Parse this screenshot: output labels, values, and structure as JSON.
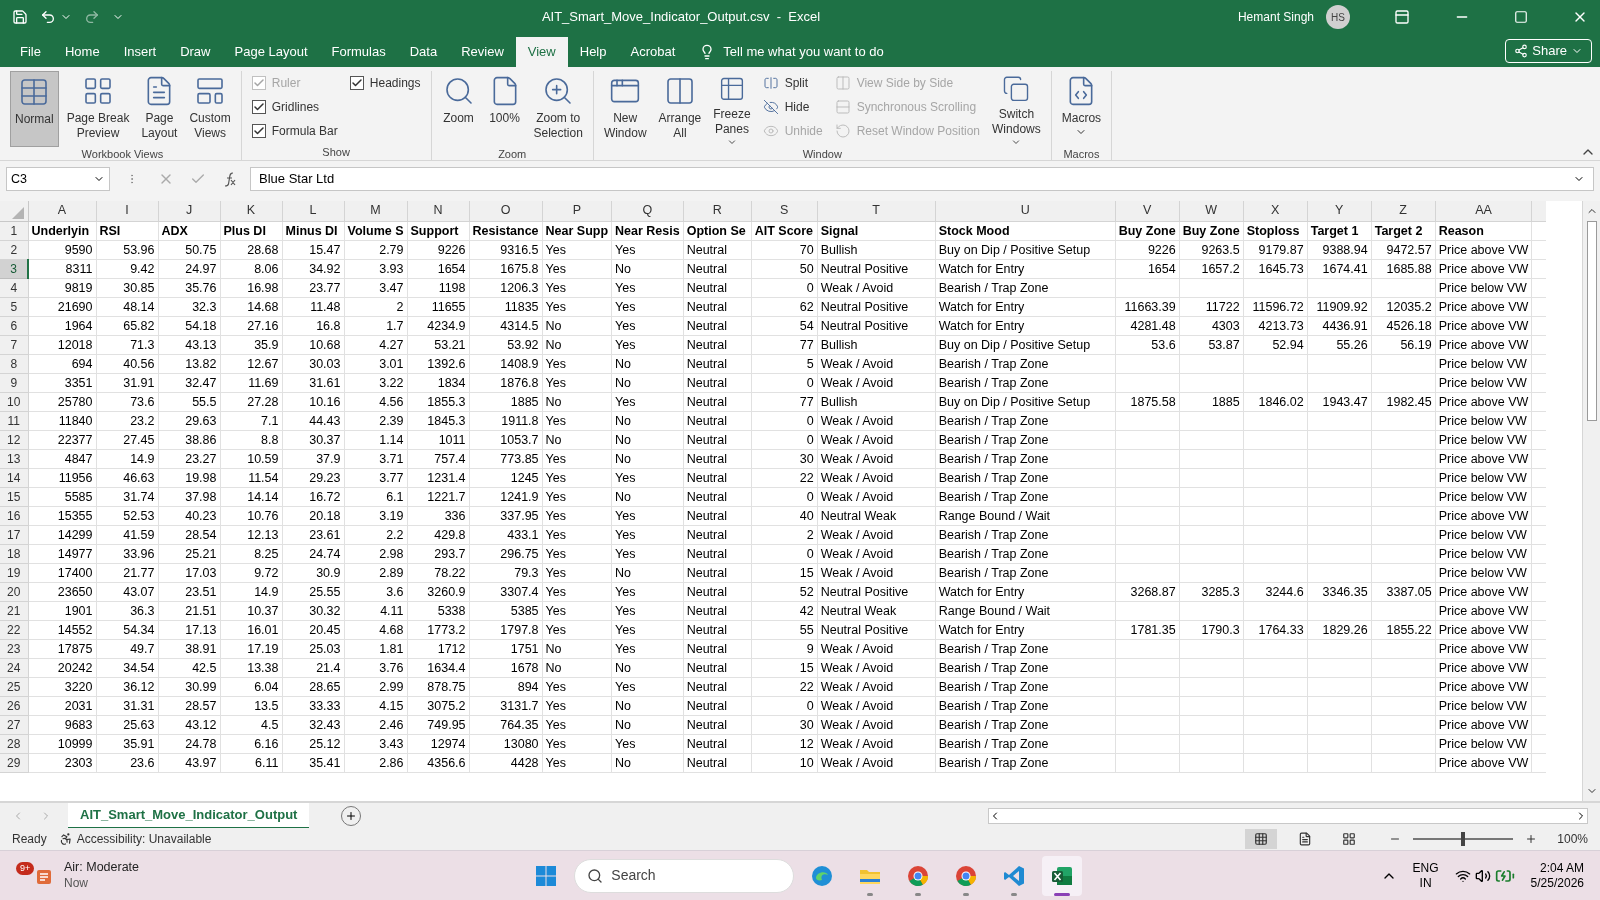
{
  "title_bar": {
    "file_title": "AIT_Smart_Move_Indicator_Output.csv  -  Excel",
    "user_name": "Hemant Singh",
    "user_initials": "HS"
  },
  "ribbon_tabs": [
    {
      "label": "File",
      "selected": false
    },
    {
      "label": "Home",
      "selected": false
    },
    {
      "label": "Insert",
      "selected": false
    },
    {
      "label": "Draw",
      "selected": false
    },
    {
      "label": "Page Layout",
      "selected": false
    },
    {
      "label": "Formulas",
      "selected": false
    },
    {
      "label": "Data",
      "selected": false
    },
    {
      "label": "Review",
      "selected": false
    },
    {
      "label": "View",
      "selected": true
    },
    {
      "label": "Help",
      "selected": false
    },
    {
      "label": "Acrobat",
      "selected": false
    }
  ],
  "tell_me": "Tell me what you want to do",
  "share": "Share",
  "ribbon_groups": [
    {
      "name": "Workbook Views",
      "items": [
        {
          "kind": "large",
          "lines": [
            "Normal"
          ],
          "selected": true,
          "dropdown": false
        },
        {
          "kind": "large",
          "lines": [
            "Page Break",
            "Preview"
          ],
          "selected": false,
          "dropdown": false
        },
        {
          "kind": "large",
          "lines": [
            "Page",
            "Layout"
          ],
          "selected": false,
          "dropdown": false
        },
        {
          "kind": "large",
          "lines": [
            "Custom",
            "Views"
          ],
          "selected": false,
          "dropdown": false
        }
      ]
    },
    {
      "name": "Show",
      "items": [
        {
          "kind": "stack",
          "items": [
            {
              "kind": "check",
              "label": "Ruler",
              "checked": true,
              "disabled": true
            },
            {
              "kind": "check",
              "label": "Gridlines",
              "checked": true,
              "disabled": false
            },
            {
              "kind": "check",
              "label": "Formula Bar",
              "checked": true,
              "disabled": false
            }
          ]
        },
        {
          "kind": "stack",
          "items": [
            {
              "kind": "check",
              "label": "Headings",
              "checked": true,
              "disabled": false
            }
          ]
        }
      ]
    },
    {
      "name": "Zoom",
      "items": [
        {
          "kind": "large",
          "lines": [
            "Zoom"
          ],
          "selected": false,
          "dropdown": false
        },
        {
          "kind": "large",
          "lines": [
            "100%"
          ],
          "selected": false,
          "dropdown": false
        },
        {
          "kind": "large",
          "lines": [
            "Zoom to",
            "Selection"
          ],
          "selected": false,
          "dropdown": false
        }
      ]
    },
    {
      "name": "Window",
      "items": [
        {
          "kind": "large",
          "lines": [
            "New",
            "Window"
          ],
          "selected": false,
          "dropdown": false
        },
        {
          "kind": "large",
          "lines": [
            "Arrange",
            "All"
          ],
          "selected": false,
          "dropdown": false
        },
        {
          "kind": "large",
          "lines": [
            "Freeze",
            "Panes"
          ],
          "selected": false,
          "dropdown": true
        },
        {
          "kind": "stack",
          "items": [
            {
              "kind": "small",
              "label": "Split",
              "disabled": false
            },
            {
              "kind": "small",
              "label": "Hide",
              "disabled": false
            },
            {
              "kind": "small",
              "label": "Unhide",
              "disabled": true
            }
          ]
        },
        {
          "kind": "stack",
          "items": [
            {
              "kind": "small",
              "label": "View Side by Side",
              "disabled": true
            },
            {
              "kind": "small",
              "label": "Synchronous Scrolling",
              "disabled": true
            },
            {
              "kind": "small",
              "label": "Reset Window Position",
              "disabled": true
            }
          ]
        },
        {
          "kind": "large",
          "lines": [
            "Switch",
            "Windows"
          ],
          "selected": false,
          "dropdown": true
        }
      ]
    },
    {
      "name": "Macros",
      "items": [
        {
          "kind": "large",
          "lines": [
            "Macros"
          ],
          "selected": false,
          "dropdown": true
        }
      ]
    }
  ],
  "formula_bar": {
    "name_box": "C3",
    "formula": "Blue Star Ltd"
  },
  "sheet": {
    "columns": [
      {
        "letter": "A"
      },
      {
        "letter": "I"
      },
      {
        "letter": "J"
      },
      {
        "letter": "K"
      },
      {
        "letter": "L"
      },
      {
        "letter": "M"
      },
      {
        "letter": "N"
      },
      {
        "letter": "O"
      },
      {
        "letter": "P"
      },
      {
        "letter": "Q"
      },
      {
        "letter": "R"
      },
      {
        "letter": "S"
      },
      {
        "letter": "T"
      },
      {
        "letter": "U"
      },
      {
        "letter": "V"
      },
      {
        "letter": "W"
      },
      {
        "letter": "X"
      },
      {
        "letter": "Y"
      },
      {
        "letter": "Z"
      },
      {
        "letter": "AA"
      }
    ],
    "header_row": {
      "number": "1",
      "selected": false,
      "cells": [
        "Underlyin",
        "RSI",
        "ADX",
        "Plus DI",
        "Minus DI",
        "Volume S",
        "Support",
        "Resistance",
        "Near Supp",
        "Near Resis",
        "Option Se",
        "AIT Score",
        "Signal",
        "Stock Mood",
        "Buy Zone",
        "Buy Zone",
        "Stoploss",
        "Target 1",
        "Target 2",
        "Reason"
      ]
    },
    "rows": [
      {
        "number": "2",
        "selected": false,
        "cells": [
          "9590",
          "53.96",
          "50.75",
          "28.68",
          "15.47",
          "2.79",
          "9226",
          "9316.5",
          "Yes",
          "Yes",
          "Neutral",
          "70",
          "Bullish",
          "Buy on Dip / Positive Setup",
          "9226",
          "9263.5",
          "9179.87",
          "9388.94",
          "9472.57",
          "Price above VW"
        ]
      },
      {
        "number": "3",
        "selected": true,
        "cells": [
          "8311",
          "9.42",
          "24.97",
          "8.06",
          "34.92",
          "3.93",
          "1654",
          "1675.8",
          "Yes",
          "No",
          "Neutral",
          "50",
          "Neutral Positive",
          "Watch for Entry",
          "1654",
          "1657.2",
          "1645.73",
          "1674.41",
          "1685.88",
          "Price above VW"
        ]
      },
      {
        "number": "4",
        "selected": false,
        "cells": [
          "9819",
          "30.85",
          "35.76",
          "16.98",
          "23.77",
          "3.47",
          "1198",
          "1206.3",
          "Yes",
          "Yes",
          "Neutral",
          "0",
          "Weak / Avoid",
          "Bearish / Trap Zone",
          null,
          null,
          null,
          null,
          null,
          "Price below VW"
        ]
      },
      {
        "number": "5",
        "selected": false,
        "cells": [
          "21690",
          "48.14",
          "32.3",
          "14.68",
          "11.48",
          "2",
          "11655",
          "11835",
          "Yes",
          "Yes",
          "Neutral",
          "62",
          "Neutral Positive",
          "Watch for Entry",
          "11663.39",
          "11722",
          "11596.72",
          "11909.92",
          "12035.2",
          "Price above VW"
        ]
      },
      {
        "number": "6",
        "selected": false,
        "cells": [
          "1964",
          "65.82",
          "54.18",
          "27.16",
          "16.8",
          "1.7",
          "4234.9",
          "4314.5",
          "No",
          "Yes",
          "Neutral",
          "54",
          "Neutral Positive",
          "Watch for Entry",
          "4281.48",
          "4303",
          "4213.73",
          "4436.91",
          "4526.18",
          "Price above VW"
        ]
      },
      {
        "number": "7",
        "selected": false,
        "cells": [
          "12018",
          "71.3",
          "43.13",
          "35.9",
          "10.68",
          "4.27",
          "53.21",
          "53.92",
          "No",
          "Yes",
          "Neutral",
          "77",
          "Bullish",
          "Buy on Dip / Positive Setup",
          "53.6",
          "53.87",
          "52.94",
          "55.26",
          "56.19",
          "Price above VW"
        ]
      },
      {
        "number": "8",
        "selected": false,
        "cells": [
          "694",
          "40.56",
          "13.82",
          "12.67",
          "30.03",
          "3.01",
          "1392.6",
          "1408.9",
          "Yes",
          "No",
          "Neutral",
          "5",
          "Weak / Avoid",
          "Bearish / Trap Zone",
          null,
          null,
          null,
          null,
          null,
          "Price below VW"
        ]
      },
      {
        "number": "9",
        "selected": false,
        "cells": [
          "3351",
          "31.91",
          "32.47",
          "11.69",
          "31.61",
          "3.22",
          "1834",
          "1876.8",
          "Yes",
          "No",
          "Neutral",
          "0",
          "Weak / Avoid",
          "Bearish / Trap Zone",
          null,
          null,
          null,
          null,
          null,
          "Price below VW"
        ]
      },
      {
        "number": "10",
        "selected": false,
        "cells": [
          "25780",
          "73.6",
          "55.5",
          "27.28",
          "10.16",
          "4.56",
          "1855.3",
          "1885",
          "No",
          "Yes",
          "Neutral",
          "77",
          "Bullish",
          "Buy on Dip / Positive Setup",
          "1875.58",
          "1885",
          "1846.02",
          "1943.47",
          "1982.45",
          "Price above VW"
        ]
      },
      {
        "number": "11",
        "selected": false,
        "cells": [
          "11840",
          "23.2",
          "29.63",
          "7.1",
          "44.43",
          "2.39",
          "1845.3",
          "1911.8",
          "Yes",
          "No",
          "Neutral",
          "0",
          "Weak / Avoid",
          "Bearish / Trap Zone",
          null,
          null,
          null,
          null,
          null,
          "Price below VW"
        ]
      },
      {
        "number": "12",
        "selected": false,
        "cells": [
          "22377",
          "27.45",
          "38.86",
          "8.8",
          "30.37",
          "1.14",
          "1011",
          "1053.7",
          "No",
          "No",
          "Neutral",
          "0",
          "Weak / Avoid",
          "Bearish / Trap Zone",
          null,
          null,
          null,
          null,
          null,
          "Price below VW"
        ]
      },
      {
        "number": "13",
        "selected": false,
        "cells": [
          "4847",
          "14.9",
          "23.27",
          "10.59",
          "37.9",
          "3.71",
          "757.4",
          "773.85",
          "Yes",
          "No",
          "Neutral",
          "30",
          "Weak / Avoid",
          "Bearish / Trap Zone",
          null,
          null,
          null,
          null,
          null,
          "Price above VW"
        ]
      },
      {
        "number": "14",
        "selected": false,
        "cells": [
          "11956",
          "46.63",
          "19.98",
          "11.54",
          "29.23",
          "3.77",
          "1231.4",
          "1245",
          "Yes",
          "Yes",
          "Neutral",
          "22",
          "Weak / Avoid",
          "Bearish / Trap Zone",
          null,
          null,
          null,
          null,
          null,
          "Price below VW"
        ]
      },
      {
        "number": "15",
        "selected": false,
        "cells": [
          "5585",
          "31.74",
          "37.98",
          "14.14",
          "16.72",
          "6.1",
          "1221.7",
          "1241.9",
          "Yes",
          "No",
          "Neutral",
          "0",
          "Weak / Avoid",
          "Bearish / Trap Zone",
          null,
          null,
          null,
          null,
          null,
          "Price below VW"
        ]
      },
      {
        "number": "16",
        "selected": false,
        "cells": [
          "15355",
          "52.53",
          "40.23",
          "10.76",
          "20.18",
          "3.19",
          "336",
          "337.95",
          "Yes",
          "Yes",
          "Neutral",
          "40",
          "Neutral Weak",
          "Range Bound / Wait",
          null,
          null,
          null,
          null,
          null,
          "Price above VW"
        ]
      },
      {
        "number": "17",
        "selected": false,
        "cells": [
          "14299",
          "41.59",
          "28.54",
          "12.13",
          "23.61",
          "2.2",
          "429.8",
          "433.1",
          "Yes",
          "Yes",
          "Neutral",
          "2",
          "Weak / Avoid",
          "Bearish / Trap Zone",
          null,
          null,
          null,
          null,
          null,
          "Price below VW"
        ]
      },
      {
        "number": "18",
        "selected": false,
        "cells": [
          "14977",
          "33.96",
          "25.21",
          "8.25",
          "24.74",
          "2.98",
          "293.7",
          "296.75",
          "Yes",
          "Yes",
          "Neutral",
          "0",
          "Weak / Avoid",
          "Bearish / Trap Zone",
          null,
          null,
          null,
          null,
          null,
          "Price below VW"
        ]
      },
      {
        "number": "19",
        "selected": false,
        "cells": [
          "17400",
          "21.77",
          "17.03",
          "9.72",
          "30.9",
          "2.89",
          "78.22",
          "79.3",
          "Yes",
          "No",
          "Neutral",
          "15",
          "Weak / Avoid",
          "Bearish / Trap Zone",
          null,
          null,
          null,
          null,
          null,
          "Price below VW"
        ]
      },
      {
        "number": "20",
        "selected": false,
        "cells": [
          "23650",
          "43.07",
          "23.51",
          "14.9",
          "25.55",
          "3.6",
          "3260.9",
          "3307.4",
          "Yes",
          "Yes",
          "Neutral",
          "52",
          "Neutral Positive",
          "Watch for Entry",
          "3268.87",
          "3285.3",
          "3244.6",
          "3346.35",
          "3387.05",
          "Price above VW"
        ]
      },
      {
        "number": "21",
        "selected": false,
        "cells": [
          "1901",
          "36.3",
          "21.51",
          "10.37",
          "30.32",
          "4.11",
          "5338",
          "5385",
          "Yes",
          "Yes",
          "Neutral",
          "42",
          "Neutral Weak",
          "Range Bound / Wait",
          null,
          null,
          null,
          null,
          null,
          "Price above VW"
        ]
      },
      {
        "number": "22",
        "selected": false,
        "cells": [
          "14552",
          "54.34",
          "17.13",
          "16.01",
          "20.45",
          "4.68",
          "1773.2",
          "1797.8",
          "Yes",
          "Yes",
          "Neutral",
          "55",
          "Neutral Positive",
          "Watch for Entry",
          "1781.35",
          "1790.3",
          "1764.33",
          "1829.26",
          "1855.22",
          "Price above VW"
        ]
      },
      {
        "number": "23",
        "selected": false,
        "cells": [
          "17875",
          "49.7",
          "38.91",
          "17.19",
          "25.03",
          "1.81",
          "1712",
          "1751",
          "No",
          "Yes",
          "Neutral",
          "9",
          "Weak / Avoid",
          "Bearish / Trap Zone",
          null,
          null,
          null,
          null,
          null,
          "Price above VW"
        ]
      },
      {
        "number": "24",
        "selected": false,
        "cells": [
          "20242",
          "34.54",
          "42.5",
          "13.38",
          "21.4",
          "3.76",
          "1634.4",
          "1678",
          "No",
          "No",
          "Neutral",
          "15",
          "Weak / Avoid",
          "Bearish / Trap Zone",
          null,
          null,
          null,
          null,
          null,
          "Price above VW"
        ]
      },
      {
        "number": "25",
        "selected": false,
        "cells": [
          "3220",
          "36.12",
          "30.99",
          "6.04",
          "28.65",
          "2.99",
          "878.75",
          "894",
          "Yes",
          "Yes",
          "Neutral",
          "22",
          "Weak / Avoid",
          "Bearish / Trap Zone",
          null,
          null,
          null,
          null,
          null,
          "Price above VW"
        ]
      },
      {
        "number": "26",
        "selected": false,
        "cells": [
          "2031",
          "31.31",
          "28.57",
          "13.5",
          "33.33",
          "4.15",
          "3075.2",
          "3131.7",
          "Yes",
          "No",
          "Neutral",
          "0",
          "Weak / Avoid",
          "Bearish / Trap Zone",
          null,
          null,
          null,
          null,
          null,
          "Price below VW"
        ]
      },
      {
        "number": "27",
        "selected": false,
        "cells": [
          "9683",
          "25.63",
          "43.12",
          "4.5",
          "32.43",
          "2.46",
          "749.95",
          "764.35",
          "Yes",
          "No",
          "Neutral",
          "30",
          "Weak / Avoid",
          "Bearish / Trap Zone",
          null,
          null,
          null,
          null,
          null,
          "Price above VW"
        ]
      },
      {
        "number": "28",
        "selected": false,
        "cells": [
          "10999",
          "35.91",
          "24.78",
          "6.16",
          "25.12",
          "3.43",
          "12974",
          "13080",
          "Yes",
          "Yes",
          "Neutral",
          "12",
          "Weak / Avoid",
          "Bearish / Trap Zone",
          null,
          null,
          null,
          null,
          null,
          "Price below VW"
        ]
      },
      {
        "number": "29",
        "selected": false,
        "cells": [
          "2303",
          "23.6",
          "43.97",
          "6.11",
          "35.41",
          "2.86",
          "4356.6",
          "4428",
          "Yes",
          "No",
          "Neutral",
          "10",
          "Weak / Avoid",
          "Bearish / Trap Zone",
          null,
          null,
          null,
          null,
          null,
          "Price above VW"
        ]
      }
    ]
  },
  "sheet_tabs": [
    {
      "label": "AIT_Smart_Move_Indicator_Output",
      "selected": true
    }
  ],
  "status_bar": {
    "mode": "Ready",
    "accessibility": "Accessibility: Unavailable",
    "view_buttons": [
      {
        "kind": "normal",
        "selected": true
      },
      {
        "kind": "page_layout",
        "selected": false
      },
      {
        "kind": "page_break",
        "selected": false
      }
    ],
    "zoom": {
      "level": 0.5,
      "reading": "100%"
    }
  },
  "taskbar": {
    "weather": {
      "badge": "9+",
      "title": "Air: Moderate",
      "subtitle": "Now"
    },
    "search": {
      "placeholder": "Search"
    },
    "apps": [
      {
        "kind": "edge",
        "running": false,
        "active": false
      },
      {
        "kind": "folder",
        "running": true,
        "active": false
      },
      {
        "kind": "chrome",
        "running": true,
        "active": false
      },
      {
        "kind": "chrome",
        "running": true,
        "active": false
      },
      {
        "kind": "vscode",
        "running": true,
        "active": false
      },
      {
        "kind": "excel",
        "running": true,
        "active": true
      }
    ],
    "language": [
      "ENG",
      "IN"
    ],
    "time": "2:04 AM",
    "date": "5/25/2026"
  }
}
